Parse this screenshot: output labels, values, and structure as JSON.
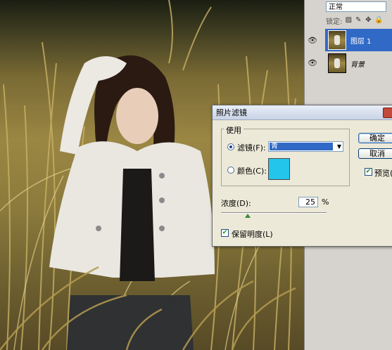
{
  "layers_panel": {
    "blend_mode": "正常",
    "lock_label": "锁定:",
    "layers": [
      {
        "name": "图层 1",
        "selected": true,
        "visible": true
      },
      {
        "name": "背景",
        "selected": false,
        "visible": true
      }
    ]
  },
  "dialog": {
    "title": "照片滤镜",
    "use_group_label": "使用",
    "filter_option_label": "滤镜(F):",
    "filter_value": "青",
    "color_option_label": "颜色(C):",
    "color_swatch": "#23c5ea",
    "density_label": "浓度(D):",
    "density_value": "25",
    "density_unit": "%",
    "density_level": 0.25,
    "preserve_luminosity_label": "保留明度(L)",
    "preserve_luminosity_checked": true,
    "ok_label": "确定",
    "cancel_label": "取消",
    "preview_label": "预览(P)",
    "preview_checked": true,
    "selected_option": "filter"
  },
  "colors": {
    "selection": "#3169c6",
    "dialog_bg": "#ece9d8",
    "panel_bg": "#d6d3ce"
  }
}
